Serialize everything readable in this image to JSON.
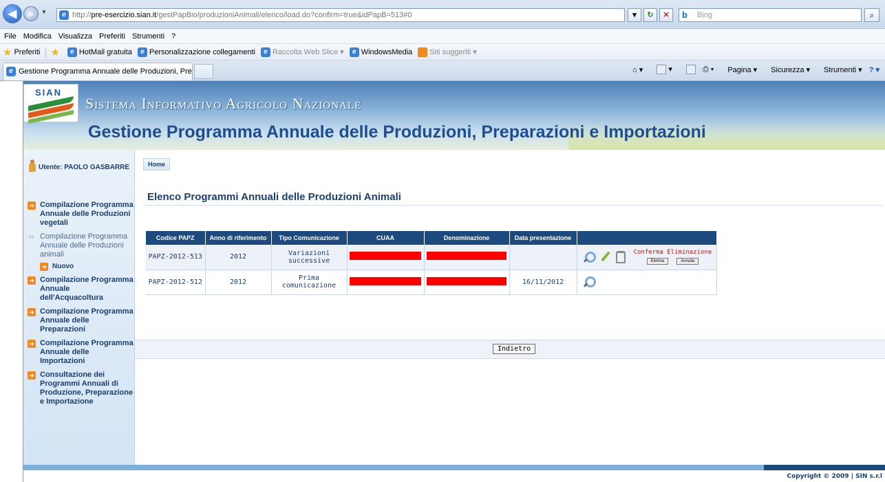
{
  "browser": {
    "url_prefix": "http://",
    "url_domain": "pre-esercizio.sian.it",
    "url_path": "/gestPapBio/produzioniAnimali/elenco/load.do?confirm=true&idPapB=513#0",
    "search_placeholder": "Bing",
    "menu": [
      "File",
      "Modifica",
      "Visualizza",
      "Preferiti",
      "Strumenti",
      "?"
    ],
    "favorites_label": "Preferiti",
    "favorites": [
      "HotMail gratuita",
      "Personalizzazione collegamenti",
      "Raccolta Web Slice",
      "WindowsMedia",
      "Siti suggeriti"
    ],
    "tab_title": "Gestione Programma Annuale delle Produzioni, Prepar...",
    "commands": [
      "Pagina",
      "Sicurezza",
      "Strumenti"
    ]
  },
  "header": {
    "logo_text": "SIAN",
    "site_name": "Sistema Informativo Agricolo Nazionale",
    "app_title": "Gestione Programma Annuale delle Produzioni, Preparazioni e Importazioni"
  },
  "sidebar": {
    "user": "Utente: PAOLO GASBARRE",
    "items": [
      {
        "label": "Compilazione Programma Annuale delle Produzioni vegetali"
      },
      {
        "label": "Compilazione Programma Annuale delle Produzioni animali"
      },
      {
        "label": "Nuovo"
      },
      {
        "label": "Compilazione Programma Annuale dell'Acquacoltura"
      },
      {
        "label": "Compilazione Programma Annuale delle Preparazioni"
      },
      {
        "label": "Compilazione Programma Annuale delle Importazioni"
      },
      {
        "label": "Consultazione dei Programmi Annuali di Produzione, Preparazione e Importazione"
      }
    ]
  },
  "main": {
    "home_label": "Home",
    "page_title": "Elenco Programmi Annuali delle Produzioni Animali",
    "table": {
      "headers": [
        "Codice PAPZ",
        "Anno di riferimento",
        "Tipo Comunicazione",
        "CUAA",
        "Denominazione",
        "Data presentazione",
        ""
      ],
      "rows": [
        {
          "codice": "PAPZ-2012-513",
          "anno": "2012",
          "tipo": "Variazioni successive",
          "data": ""
        },
        {
          "codice": "PAPZ-2012-512",
          "anno": "2012",
          "tipo": "Prima comunicazione",
          "data": "16/11/2012"
        }
      ],
      "confirm_text": "Conferma Eliminazione",
      "delete_label": "Elimina",
      "cancel_label": "Annulla"
    },
    "back_label": "Indietro"
  },
  "footer": {
    "copyright": "Copyright © 2009 | SIN s.r.l"
  },
  "colors": {
    "primary": "#1c4a7e",
    "accent": "#f08a1c",
    "redaction": "#ff0000"
  }
}
